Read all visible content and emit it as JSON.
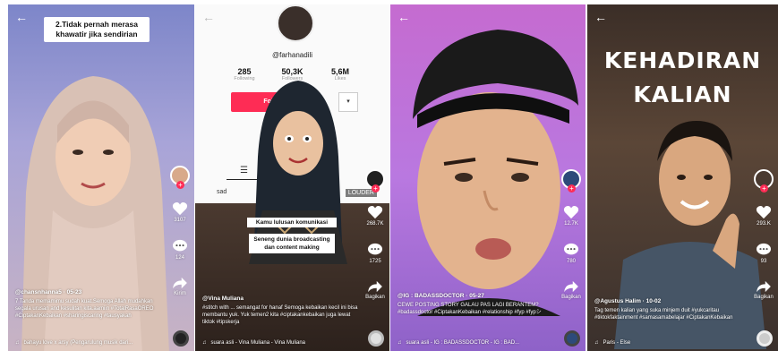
{
  "panels": [
    {
      "id": "p1",
      "banner": "2.Tidak pernah merasa khawatir jika sendirian",
      "rail": {
        "likes": "3107",
        "comments": "124",
        "share": "Kirim"
      },
      "caption": {
        "handle": "@chansnhanna5 · 05-23",
        "text": "7 Tanda memamimu sudah kuat.Semoga Allah mudahkan segala urusan and kesulitan kita.aamiin #TotalRasaOREO #CiptakanKebaikan #sharingiscaring #tausyakah"
      },
      "music": "bahayu love x arsy (Pengarulung musik dari..."
    },
    {
      "id": "p2",
      "username": "@farhanadili",
      "stats": [
        {
          "value": "285",
          "label": "Following"
        },
        {
          "value": "50,3K",
          "label": "Followers"
        },
        {
          "value": "5,6M",
          "label": "Likes"
        }
      ],
      "follow_label": "Follow",
      "dropdown_glyph": "▾",
      "tab_label_left": "sad",
      "tab_label_right": "LOUDER",
      "overlays": [
        "Kamu lulusan komunikasi",
        "Seneng dunia broadcasting dan content making"
      ],
      "rail": {
        "likes": "268.7K",
        "comments": "1725",
        "share": "Bagikan"
      },
      "caption": {
        "handle": "@Vina Muliana",
        "text": "#stitch with ... semangat for hanaf Semoga kebaikan kecil ini bisa membantu yuk. Yuk temen2 kita #ciptakankebaikan juga lewat tiktok #tipskerja"
      },
      "music": "suara asli - Vina Muliana - Vina Muliana"
    },
    {
      "id": "p3",
      "rail": {
        "likes": "12.7K",
        "comments": "780",
        "share": "Bagikan"
      },
      "caption": {
        "handle": "@IG : BADASSDOCTOR · 05-27",
        "text": "CEWE POSTING STORY GALAU PAS LAGI BERANTEM? #badassdoctor #CiptakanKebaikan #relationship #fyp #fypシ"
      },
      "music": "suara asli - IG : BADASSDOCTOR - IG : BAD..."
    },
    {
      "id": "p4",
      "title": "KEHADIRAN KALIAN",
      "rail": {
        "likes": "293.K",
        "comments": "93",
        "share": "Bagikan"
      },
      "caption": {
        "handle": "@Agustus Halim · 10-02",
        "text": "Tag temen kalian yang suka minjem duit #yukcaritau #tiktokfaktainment #samasamabelajar #CiptakanKebaikan"
      },
      "music": "Paris - Else"
    }
  ],
  "colors": {
    "accent": "#fe2c55",
    "text_light": "#ffffff"
  }
}
